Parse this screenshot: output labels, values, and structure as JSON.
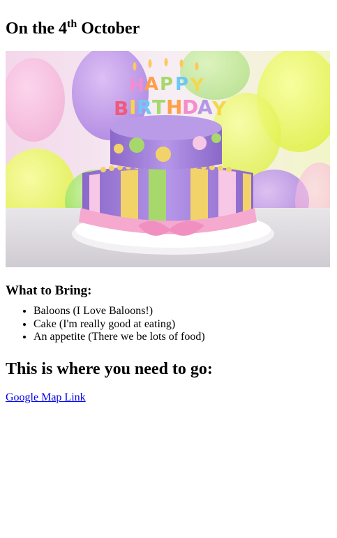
{
  "heading": {
    "prefix": "On the 4",
    "superscript": "th",
    "suffix": " October"
  },
  "hero_image": {
    "alt": "Happy Birthday cake",
    "topper_text": "HAPPY BIRTHDAY"
  },
  "bring": {
    "title": "What to Bring:",
    "items": [
      "Baloons (I Love Baloons!)",
      "Cake (I'm really good at eating)",
      "An appetite (There we be lots of food)"
    ]
  },
  "directions": {
    "title": "This is where you need to go:",
    "link_label": "Google Map Link"
  },
  "colors": {
    "link": "#0000ee"
  }
}
